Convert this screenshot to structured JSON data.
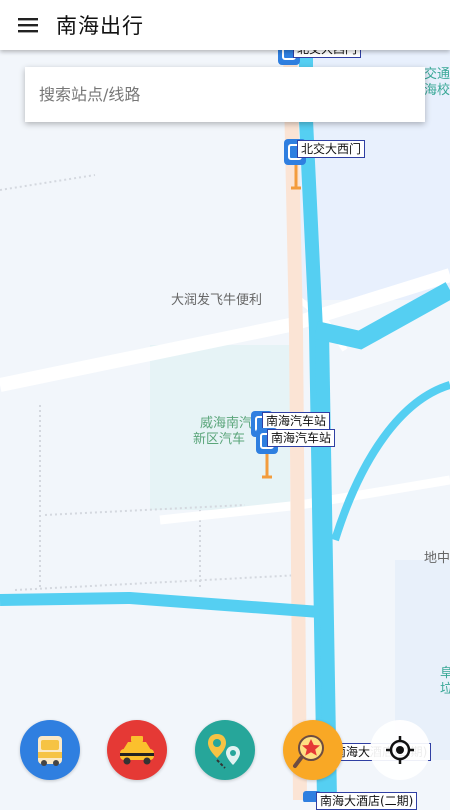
{
  "app_bar": {
    "title": "南海出行"
  },
  "search": {
    "placeholder": "搜索站点/线路"
  },
  "map": {
    "poi": [
      {
        "text": "大润发飞牛便利"
      },
      {
        "text": "威海南汽"
      },
      {
        "text": "新区汽车"
      },
      {
        "text": "交通"
      },
      {
        "text": "海校"
      },
      {
        "text": "地中"
      },
      {
        "text": "阜"
      },
      {
        "text": "垃"
      }
    ],
    "stops": [
      {
        "label": "北交大西门"
      },
      {
        "label": "北交大西门"
      },
      {
        "label": "南海汽车站"
      },
      {
        "label": "南海汽车站"
      },
      {
        "label": "南海大酒店(二期)"
      },
      {
        "label": "南海大酒店(二期)"
      }
    ]
  },
  "bottom_actions": [
    {
      "name": "bus",
      "color": "#2f7fe0"
    },
    {
      "name": "taxi",
      "color": "#e53935"
    },
    {
      "name": "route",
      "color": "#26a69a"
    },
    {
      "name": "favorite-search",
      "color": "#f9a825"
    }
  ]
}
